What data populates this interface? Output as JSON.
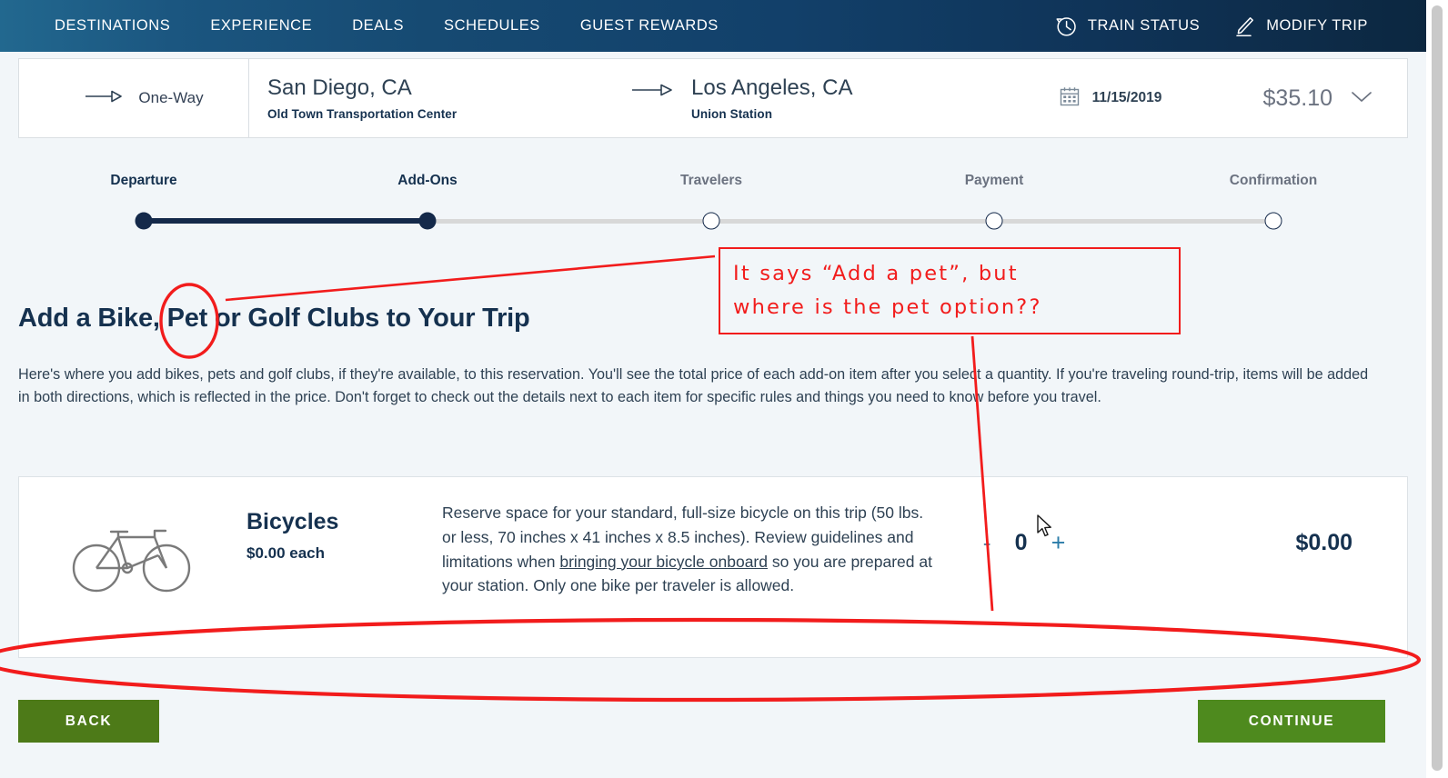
{
  "nav": {
    "links": [
      {
        "label": "DESTINATIONS"
      },
      {
        "label": "EXPERIENCE"
      },
      {
        "label": "DEALS"
      },
      {
        "label": "SCHEDULES"
      },
      {
        "label": "GUEST REWARDS"
      }
    ],
    "utilities": [
      {
        "label": "TRAIN STATUS",
        "icon": "clock-history-icon"
      },
      {
        "label": "MODIFY TRIP",
        "icon": "pencil-icon"
      }
    ]
  },
  "trip": {
    "type_label": "One-Way",
    "type_icon": "arrow-right-icon",
    "origin_city": "San Diego, CA",
    "origin_station": "Old Town Transportation Center",
    "middle_icon": "arrow-right-icon",
    "destination_city": "Los Angeles, CA",
    "destination_station": "Union Station",
    "date_icon": "calendar-icon",
    "date": "11/15/2019",
    "price": "$35.10",
    "expand_icon": "chevron-down-icon"
  },
  "stepper": {
    "steps": [
      {
        "label": "Departure",
        "state": "done"
      },
      {
        "label": "Add-Ons",
        "state": "done"
      },
      {
        "label": "Travelers",
        "state": "todo"
      },
      {
        "label": "Payment",
        "state": "todo"
      },
      {
        "label": "Confirmation",
        "state": "todo"
      }
    ]
  },
  "main": {
    "title": "Add a Bike, Pet or Golf Clubs to Your Trip",
    "intro": "Here's where you add bikes, pets and golf clubs, if they're available, to this reservation. You'll see the total price of each add-on item after you select a quantity. If you're traveling round-trip, items will be added in both directions, which is reflected in the price. Don't forget to check out the details next to each item for specific rules and things you need to know before you travel."
  },
  "addon": {
    "icon": "bicycle-icon",
    "name": "Bicycles",
    "unit_price": "$0.00 each",
    "desc_part1": "Reserve space for your standard, full-size bicycle on this trip (50 lbs. or less, 70 inches x 41 inches x 8.5 inches). Review guidelines and limitations when ",
    "desc_link": "bringing your bicycle onboard",
    "desc_part2": " so you are prepared at your station. Only one bike per traveler is allowed.",
    "minus_label": "-",
    "quantity": "0",
    "plus_label": "+",
    "total_price": "$0.00"
  },
  "footer": {
    "back_label": "BACK",
    "continue_label": "CONTINUE"
  },
  "annotation": {
    "line1": "It says “Add a pet”, but",
    "line2": "where is the pet option??",
    "color": "#f21c1c",
    "circled_word": "Pet"
  },
  "colors": {
    "nav_gradient_start": "#22688f",
    "nav_gradient_end": "#0c2740",
    "page_background": "#f2f6f9",
    "navy_text": "#15314f",
    "button_green_back": "#4d7a18",
    "button_green_continue": "#4e8a1e",
    "annotation_red": "#f21c1c",
    "stepper_done": "#14294a",
    "stepper_track": "#d8d8d8"
  }
}
